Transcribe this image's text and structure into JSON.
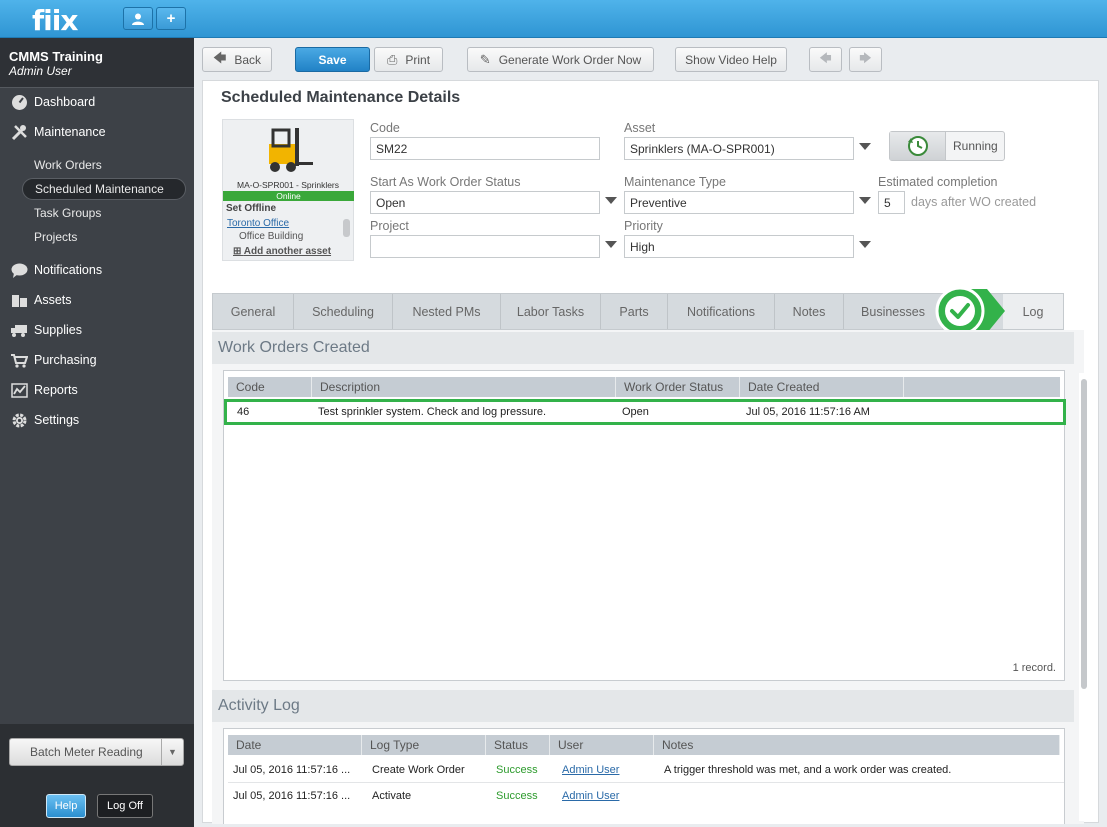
{
  "app": {
    "logo": "fiix"
  },
  "account": {
    "org": "CMMS Training",
    "user": "Admin User"
  },
  "nav": {
    "dashboard": "Dashboard",
    "maintenance": "Maintenance",
    "sub": [
      "Work Orders",
      "Scheduled Maintenance",
      "Task Groups",
      "Projects"
    ],
    "notifications": "Notifications",
    "assets": "Assets",
    "supplies": "Supplies",
    "purchasing": "Purchasing",
    "reports": "Reports",
    "settings": "Settings"
  },
  "bottom": {
    "batch": "Batch Meter Reading",
    "help": "Help",
    "logoff": "Log Off"
  },
  "toolbar": {
    "back": "Back",
    "save": "Save",
    "print": "Print",
    "generate": "Generate Work Order Now",
    "video": "Show Video Help"
  },
  "page": {
    "title": "Scheduled Maintenance Details"
  },
  "asset_card": {
    "name": "MA-O-SPR001 - Sprinklers",
    "status": "Online",
    "set_offline": "Set Offline",
    "location": "Toronto Office",
    "building": "Office Building",
    "add_asset": "Add another asset"
  },
  "form": {
    "code_label": "Code",
    "code": "SM22",
    "asset_label": "Asset",
    "asset": "Sprinklers (MA-O-SPR001)",
    "status_label": "Start As Work Order Status",
    "status": "Open",
    "mtype_label": "Maintenance Type",
    "mtype": "Preventive",
    "est_label": "Estimated completion",
    "est_value": "5",
    "est_suffix": "days after WO created",
    "project_label": "Project",
    "project": "",
    "priority_label": "Priority",
    "priority": "High",
    "running": "Running"
  },
  "tabs": [
    "General",
    "Scheduling",
    "Nested PMs",
    "Labor Tasks",
    "Parts",
    "Notifications",
    "Notes",
    "Businesses",
    "Log"
  ],
  "work_orders": {
    "title": "Work Orders Created",
    "columns": [
      "Code",
      "Description",
      "Work Order Status",
      "Date Created"
    ],
    "rows": [
      {
        "code": "46",
        "description": "Test sprinkler system. Check and log pressure.",
        "status": "Open",
        "date": "Jul 05, 2016 11:57:16 AM"
      }
    ],
    "footer": "1 record."
  },
  "activity": {
    "title": "Activity Log",
    "columns": [
      "Date",
      "Log Type",
      "Status",
      "User",
      "Notes"
    ],
    "rows": [
      {
        "date": "Jul 05, 2016 11:57:16 ...",
        "type": "Create Work Order",
        "status": "Success",
        "user": "Admin User",
        "notes": "A trigger threshold was met, and a work order was created."
      },
      {
        "date": "Jul 05, 2016 11:57:16 ...",
        "type": "Activate",
        "status": "Success",
        "user": "Admin User",
        "notes": ""
      }
    ]
  },
  "colors": {
    "accent": "#2f95d3",
    "success": "#2d9b2d",
    "highlight": "#33b24a"
  }
}
